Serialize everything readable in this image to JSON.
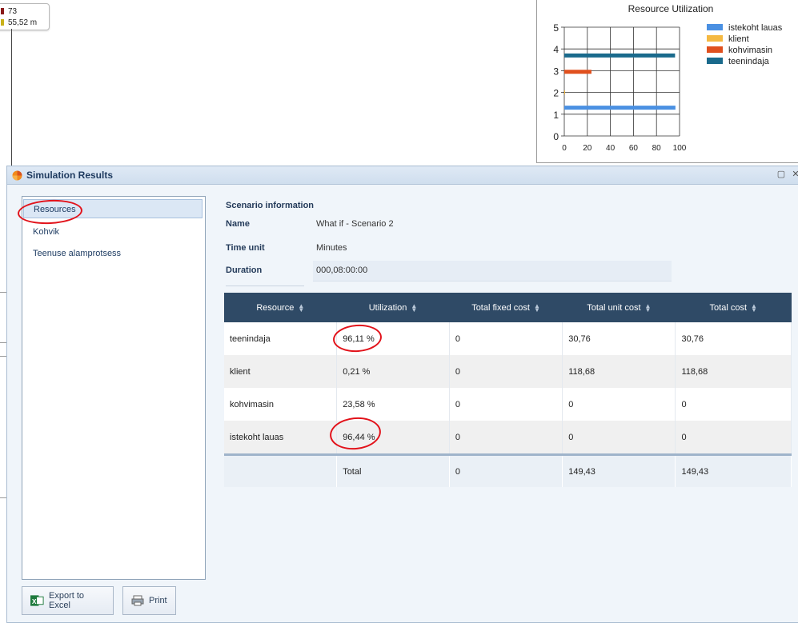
{
  "mini_legend": {
    "items": [
      {
        "label": "73",
        "color": "#8b1a1a"
      },
      {
        "label": "55,52 m",
        "color": "#c9b11a"
      }
    ]
  },
  "utilization_chart": {
    "chart_data": {
      "type": "bar",
      "orientation": "horizontal",
      "title": "Resource Utilization",
      "xlabel": "",
      "ylabel": "",
      "xlim": [
        0,
        100
      ],
      "ylim": [
        0,
        5
      ],
      "x_ticks": [
        "0",
        "20",
        "40",
        "60",
        "80",
        "100"
      ],
      "y_ticks": [
        "0",
        "1",
        "2",
        "3",
        "4",
        "5"
      ],
      "grid": true,
      "legend_position": "right",
      "series": [
        {
          "name": "istekoht lauas",
          "color": "#4a90e2",
          "y": 1.3,
          "value": 96.44
        },
        {
          "name": "klient",
          "color": "#f5b942",
          "y": 2.0,
          "value": 0.21
        },
        {
          "name": "kohvimasin",
          "color": "#e0501e",
          "y": 2.95,
          "value": 23.58
        },
        {
          "name": "teenindaja",
          "color": "#1a6a8c",
          "y": 3.7,
          "value": 96.11
        }
      ]
    }
  },
  "window": {
    "title": "Simulation Results",
    "controls": {
      "restore": "▢",
      "close": "✕"
    }
  },
  "nav": {
    "items": [
      {
        "label": "Resources",
        "selected": true
      },
      {
        "label": "Kohvik",
        "selected": false
      },
      {
        "label": "Teenuse alamprotsess",
        "selected": false
      }
    ]
  },
  "buttons": {
    "export": "Export to Excel",
    "print": "Print"
  },
  "scenario": {
    "title": "Scenario information",
    "name_label": "Name",
    "name_value": "What if - Scenario 2",
    "time_unit_label": "Time unit",
    "time_unit_value": "Minutes",
    "duration_label": "Duration",
    "duration_value": "000,08:00:00"
  },
  "table": {
    "headers": [
      "Resource",
      "Utilization",
      "Total fixed cost",
      "Total unit cost",
      "Total cost"
    ],
    "rows": [
      [
        "teenindaja",
        "96,11 %",
        "0",
        "30,76",
        "30,76"
      ],
      [
        "klient",
        "0,21 %",
        "0",
        "118,68",
        "118,68"
      ],
      [
        "kohvimasin",
        "23,58 %",
        "0",
        "0",
        "0"
      ],
      [
        "istekoht lauas",
        "96,44 %",
        "0",
        "0",
        "0"
      ]
    ],
    "total": [
      "",
      "Total",
      "0",
      "149,43",
      "149,43"
    ]
  }
}
